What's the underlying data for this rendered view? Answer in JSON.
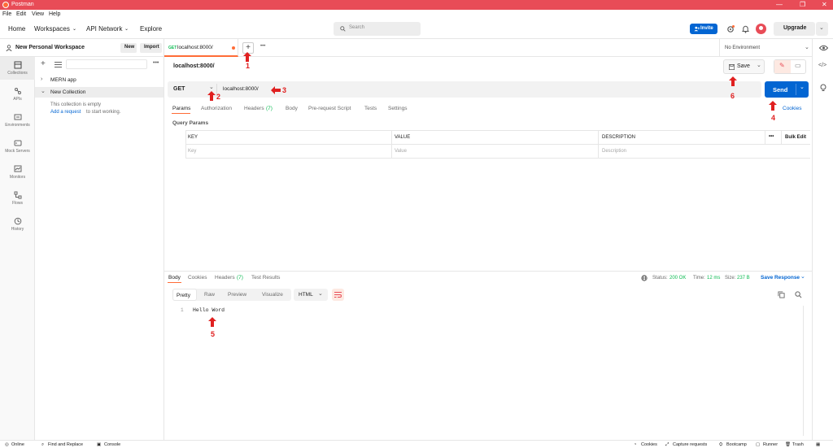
{
  "app": {
    "title": "Postman"
  },
  "menu": [
    "File",
    "Edit",
    "View",
    "Help"
  ],
  "nav": {
    "home": "Home",
    "workspaces": "Workspaces",
    "api_network": "API Network",
    "explore": "Explore",
    "search_placeholder": "Search",
    "invite": "Invite",
    "upgrade": "Upgrade"
  },
  "workspace": {
    "name": "New Personal Workspace",
    "new_btn": "New",
    "import_btn": "Import"
  },
  "sidebar_rail": [
    {
      "label": "Collections",
      "icon": "collections-icon"
    },
    {
      "label": "APIs",
      "icon": "apis-icon"
    },
    {
      "label": "Environments",
      "icon": "environments-icon"
    },
    {
      "label": "Mock Servers",
      "icon": "mock-servers-icon"
    },
    {
      "label": "Monitors",
      "icon": "monitors-icon"
    },
    {
      "label": "Flows",
      "icon": "flows-icon"
    },
    {
      "label": "History",
      "icon": "history-icon"
    }
  ],
  "collections": {
    "items": [
      "MERN app",
      "New Collection"
    ],
    "empty_text": "This collection is empty",
    "add_link": "Add a request",
    "add_suffix": " to start working."
  },
  "tab": {
    "method": "GET",
    "url": "localhost:8000/"
  },
  "environment": "No Environment",
  "request": {
    "title": "localhost:8000/",
    "save": "Save",
    "method": "GET",
    "url": "localhost:8000/",
    "send": "Send",
    "cookies": "Cookies",
    "tabs": [
      "Params",
      "Authorization",
      "Headers",
      "Body",
      "Pre-request Script",
      "Tests",
      "Settings"
    ],
    "headers_count": "(7)",
    "query_params_label": "Query Params",
    "table_headers": {
      "key": "KEY",
      "value": "VALUE",
      "description": "DESCRIPTION",
      "more": "•••",
      "bulk_edit": "Bulk Edit"
    },
    "placeholders": {
      "key": "Key",
      "value": "Value",
      "description": "Description"
    }
  },
  "response": {
    "tabs": [
      "Body",
      "Cookies",
      "Headers",
      "Test Results"
    ],
    "headers_count": "(7)",
    "status_label": "Status:",
    "status_value": "200 OK",
    "time_label": "Time:",
    "time_value": "12 ms",
    "size_label": "Size:",
    "size_value": "237 B",
    "save_response": "Save Response",
    "formats": [
      "Pretty",
      "Raw",
      "Preview",
      "Visualize"
    ],
    "lang": "HTML",
    "line_number": "1",
    "body": "Hello Word"
  },
  "annotations": [
    "1",
    "2",
    "3",
    "4",
    "5",
    "6"
  ],
  "footer": {
    "online": "Online",
    "find_replace": "Find and Replace",
    "console": "Console",
    "cookies": "Cookies",
    "capture": "Capture requests",
    "bootcamp": "Bootcamp",
    "runner": "Runner",
    "trash": "Trash"
  },
  "colors": {
    "brand": "#ff6c37",
    "primary": "#0265d2",
    "titlebar": "#e84c57",
    "annotation": "#e02020",
    "success": "#0cbb52"
  }
}
